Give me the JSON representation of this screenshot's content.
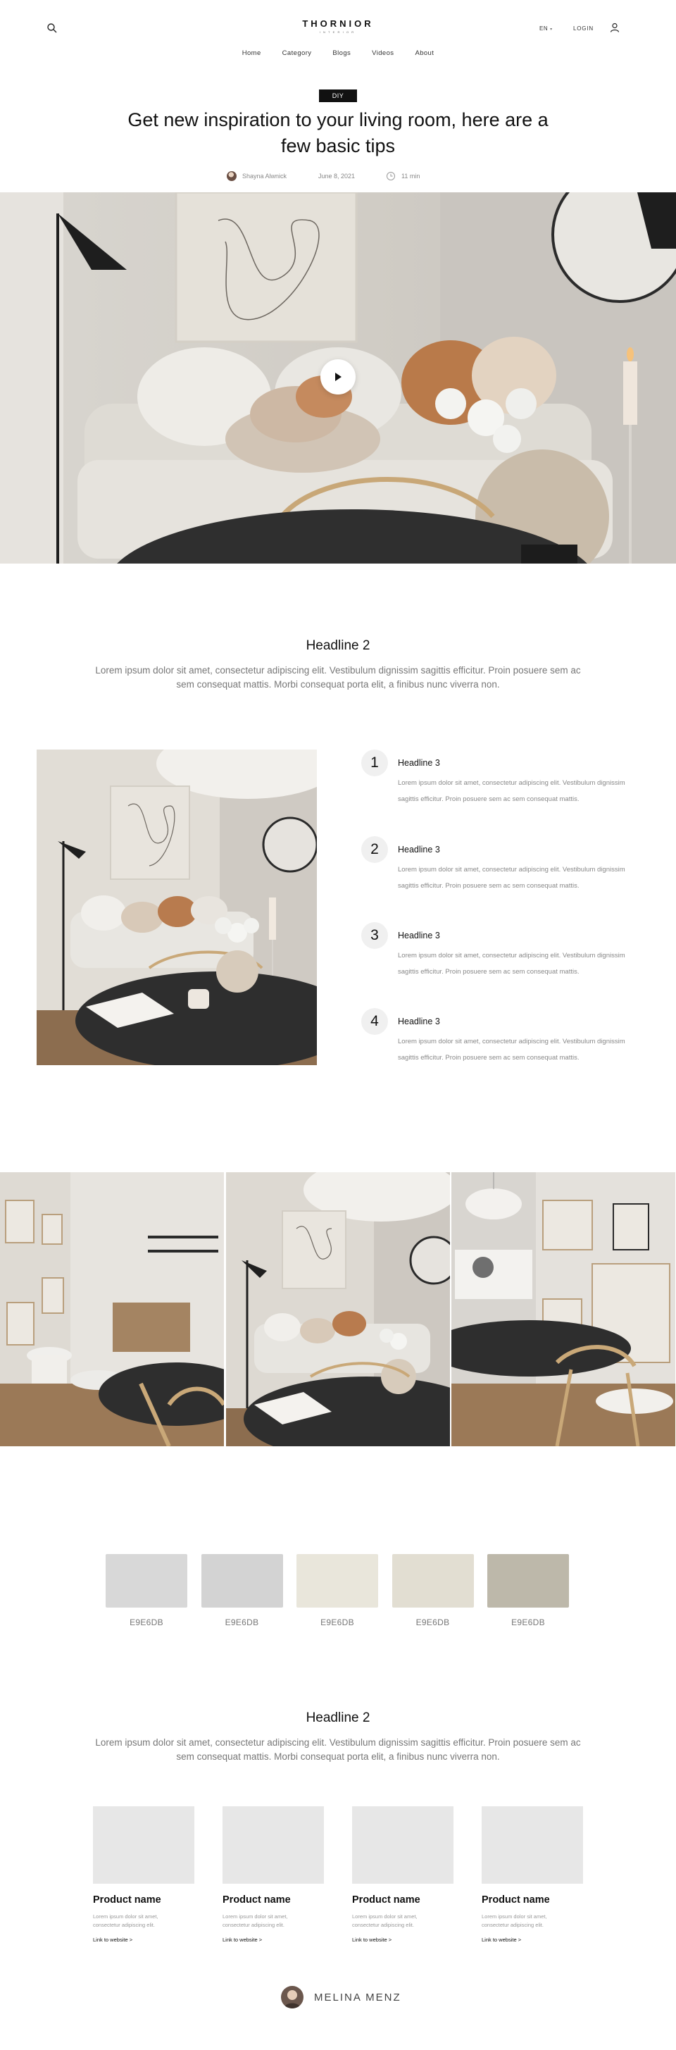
{
  "header": {
    "brand": "THORNIOR",
    "brand_sub": "INTERIOR",
    "language": "EN",
    "login": "LOGIN",
    "nav": [
      "Home",
      "Category",
      "Blogs",
      "Videos",
      "About"
    ]
  },
  "article": {
    "category": "DIY",
    "title": "Get new inspiration to your living room, here are a few basic tips",
    "author": "Shayna Alwnick",
    "date": "June 8, 2021",
    "read_time": "11 min"
  },
  "section1": {
    "headline": "Headline 2",
    "lead": "Lorem ipsum dolor sit amet, consectetur adipiscing elit. Vestibulum dignissim sagittis efficitur. Proin posuere sem ac sem consequat mattis. Morbi consequat porta elit, a finibus nunc viverra non."
  },
  "steps": [
    {
      "number": "1",
      "headline": "Headline 3",
      "text": "Lorem ipsum dolor sit amet, consectetur adipiscing elit. Vestibulum dignissim sagittis efficitur. Proin posuere sem ac sem consequat mattis."
    },
    {
      "number": "2",
      "headline": "Headline 3",
      "text": "Lorem ipsum dolor sit amet, consectetur adipiscing elit. Vestibulum dignissim sagittis efficitur. Proin posuere sem ac sem consequat mattis."
    },
    {
      "number": "3",
      "headline": "Headline 3",
      "text": "Lorem ipsum dolor sit amet, consectetur adipiscing elit. Vestibulum dignissim sagittis efficitur. Proin posuere sem ac sem consequat mattis."
    },
    {
      "number": "4",
      "headline": "Headline 3",
      "text": "Lorem ipsum dolor sit amet, consectetur adipiscing elit. Vestibulum dignissim sagittis efficitur. Proin posuere sem ac sem consequat mattis."
    }
  ],
  "swatches": [
    {
      "label": "E9E6DB",
      "color": "#d8d8d8"
    },
    {
      "label": "E9E6DB",
      "color": "#d3d3d3"
    },
    {
      "label": "E9E6DB",
      "color": "#e9e6db"
    },
    {
      "label": "E9E6DB",
      "color": "#e2ded2"
    },
    {
      "label": "E9E6DB",
      "color": "#bdb8aa"
    }
  ],
  "section2": {
    "headline": "Headline 2",
    "lead": "Lorem ipsum dolor sit amet, consectetur adipiscing elit. Vestibulum dignissim sagittis efficitur. Proin posuere sem ac sem consequat mattis. Morbi consequat porta elit, a finibus nunc viverra non."
  },
  "products": [
    {
      "name": "Product name",
      "desc": "Lorem ipsum dolor sit amet, consectetur adipiscing elit.",
      "link": "Link to website >"
    },
    {
      "name": "Product name",
      "desc": "Lorem ipsum dolor sit amet, consectetur adipiscing elit.",
      "link": "Link to website >"
    },
    {
      "name": "Product name",
      "desc": "Lorem ipsum dolor sit amet, consectetur adipiscing elit.",
      "link": "Link to website >"
    },
    {
      "name": "Product name",
      "desc": "Lorem ipsum dolor sit amet, consectetur adipiscing elit.",
      "link": "Link to website >"
    }
  ],
  "footer": {
    "author": "MELINA MENZ"
  },
  "icons": {
    "search": "search-icon",
    "user": "user-icon",
    "clock": "clock-icon",
    "play": "play-icon",
    "caret": "chevron-down-icon"
  }
}
